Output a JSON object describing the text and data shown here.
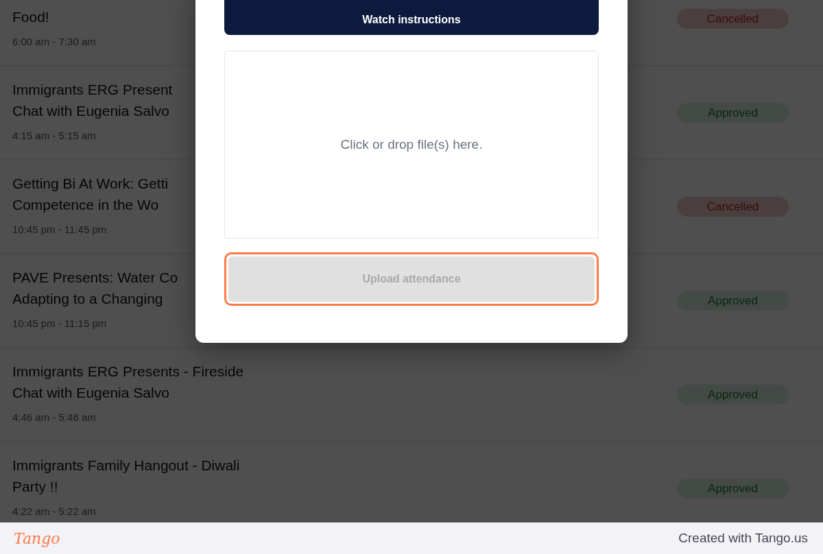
{
  "events": [
    {
      "title_lines": [
        "Food!"
      ],
      "time": "6:00 am - 7:30 am",
      "status": {
        "label": "Cancelled",
        "kind": "cancelled"
      }
    },
    {
      "title_lines": [
        "Immigrants ERG Present",
        "Chat with Eugenia Salvo"
      ],
      "time": "4:15 am - 5:15 am",
      "status": {
        "label": "Approved",
        "kind": "approved"
      }
    },
    {
      "title_lines": [
        "Getting Bi At Work: Getti",
        "Competence in the Wo"
      ],
      "time": "10:45 pm - 11:45 pm",
      "status": {
        "label": "Cancelled",
        "kind": "cancelled"
      }
    },
    {
      "title_lines": [
        "PAVE Presents: Water Co",
        "Adapting to a Changing"
      ],
      "time": "10:45 pm - 11:15 pm",
      "status": {
        "label": "Approved",
        "kind": "approved"
      }
    },
    {
      "title_lines": [
        "Immigrants ERG Presents - Fireside",
        "Chat with Eugenia Salvo"
      ],
      "time": "4:46 am - 5:46 am",
      "status": {
        "label": "Approved",
        "kind": "approved"
      }
    },
    {
      "title_lines": [
        "Immigrants Family Hangout - Diwali",
        "Party !!"
      ],
      "time": "4:22 am - 5:22 am",
      "status": {
        "label": "Approved",
        "kind": "approved"
      }
    }
  ],
  "modal": {
    "watch_button": "Watch instructions",
    "dropzone": {
      "prompt": "Click or drop file(s) here."
    },
    "upload_button": {
      "label": "Upload attendance",
      "disabled": true,
      "highlighted": true
    }
  },
  "footer": {
    "logo": "Tango",
    "credit": "Created with Tango.us"
  }
}
